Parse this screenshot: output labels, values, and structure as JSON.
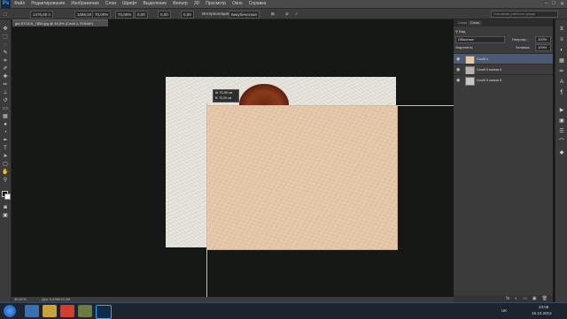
{
  "app": {
    "logo": "Ps",
    "doc_tab": "girl-STOCK_7859.jpg @ 45,5% (Слой 1, RGB/8*)"
  },
  "menu": [
    "Файл",
    "Редактирование",
    "Изображение",
    "Слои",
    "Шрифт",
    "Выделение",
    "Фильтр",
    "3D",
    "Просмотр",
    "Окно",
    "Справка"
  ],
  "window_controls": [
    "–",
    "□",
    "✕"
  ],
  "options": {
    "x": "1476,50 п",
    "y": "1086,50 п",
    "w": "70,00%",
    "h": "70,00%",
    "angle": "0,00",
    "h_skew": "0,00",
    "v_skew": "0,00",
    "interp_label": "Интерполяция:",
    "interp_value": "Бикубическая",
    "search": "Основная рабочая среда"
  },
  "transform_tip": {
    "w": "Ш: 91,56 см",
    "h": "В: 70,00 см"
  },
  "status": {
    "zoom": "45,51%",
    "doc": "Док: 5,49М/19,2М"
  },
  "panel": {
    "tabs": [
      "Слои",
      "Слои"
    ],
    "kind_label": "Вид",
    "blend_mode": "Обычные",
    "opacity_label": "Непрозр.:",
    "opacity_value": "100%",
    "lock_label": "Закрепить:",
    "fill_label": "Заливка:",
    "fill_value": "100%",
    "layers": [
      {
        "name": "Слой 1",
        "selected": true,
        "thumb": "#e6c9ab"
      },
      {
        "name": "Слой 0 копия 4",
        "selected": false,
        "thumb": "#b7b3ad"
      },
      {
        "name": "Слой 0 копия 3",
        "selected": false,
        "thumb": "#c9c5bf"
      }
    ],
    "bottom_icons": [
      "fx",
      "◐",
      "▭",
      "▣",
      "🗑"
    ]
  },
  "tray": {
    "lang": "UK",
    "time": "23:08",
    "date": "16.10.2013"
  },
  "colors": {
    "accent": "#4a5a72",
    "canvas_bg": "#161815",
    "paper": "#e6c9ab"
  }
}
